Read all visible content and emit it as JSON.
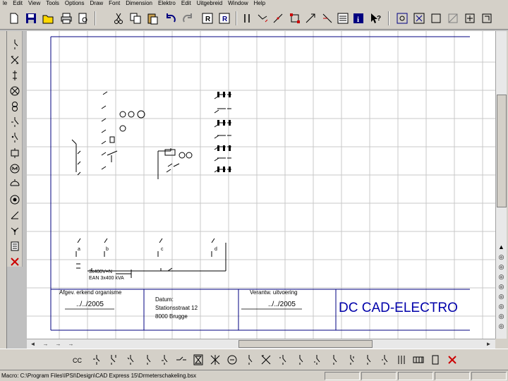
{
  "menubar": {
    "items": [
      "le",
      "Edit",
      "View",
      "Tools",
      "Options",
      "Draw",
      "Font",
      "Dimension",
      "Elektro",
      "Edit",
      "Uitgebreid",
      "Window",
      "Help"
    ]
  },
  "canvas": {
    "title_block": {
      "field1_label": "Afgev. erkend organisme",
      "field1_date": "../../2005",
      "address_line1": "Datum:",
      "address_line2": "Stationsstraat 12",
      "address_line3": "8000 Brugge",
      "field3_label": "Verantw. uitvoering",
      "field3_date": "../../2005",
      "brand": "DC CAD-ELECTRO"
    },
    "schematic": {
      "feed_label": "3x400V+N",
      "feed_sub": "EAN 3x400 kVA",
      "circuit_labels": [
        "a",
        "b",
        "c",
        "d"
      ]
    }
  },
  "statusbar": {
    "text": "Macro: C:\\Program Files\\IPSI\\Design\\CAD Express 15\\Drmeterschakeling.bsx"
  },
  "colors": {
    "chrome": "#d4d0c8",
    "frame_line": "#000080",
    "brand_text": "#0000aa"
  }
}
